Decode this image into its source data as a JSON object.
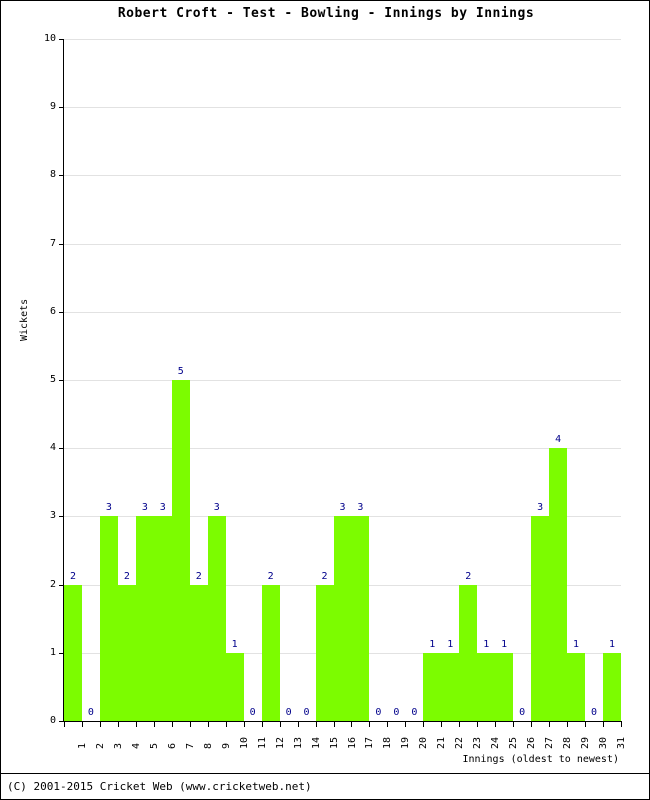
{
  "chart_data": {
    "type": "bar",
    "title": "Robert Croft - Test - Bowling - Innings by Innings",
    "xlabel": "Innings (oldest to newest)",
    "ylabel": "Wickets",
    "ylim": [
      0,
      10
    ],
    "ytick_labels": [
      "0",
      "1",
      "2",
      "3",
      "4",
      "5",
      "6",
      "7",
      "8",
      "9",
      "10"
    ],
    "grid": true,
    "legend": "none",
    "bar_color": "#7CFC00",
    "label_color": "#00008B",
    "gridline_color": "#E2E2E2",
    "axis_color": "#000000",
    "categories": [
      "1",
      "2",
      "3",
      "4",
      "5",
      "6",
      "7",
      "8",
      "9",
      "10",
      "11",
      "12",
      "13",
      "14",
      "15",
      "16",
      "17",
      "18",
      "19",
      "20",
      "21",
      "22",
      "23",
      "24",
      "25",
      "26",
      "27",
      "28",
      "29",
      "30",
      "31"
    ],
    "values": [
      2,
      0,
      3,
      2,
      3,
      3,
      5,
      2,
      3,
      1,
      0,
      2,
      0,
      0,
      2,
      3,
      3,
      0,
      0,
      0,
      1,
      1,
      2,
      1,
      1,
      0,
      3,
      4,
      1,
      0,
      1
    ],
    "data_labels": [
      "2",
      "0",
      "3",
      "2",
      "3",
      "3",
      "5",
      "2",
      "3",
      "1",
      "0",
      "2",
      "0",
      "0",
      "2",
      "3",
      "3",
      "0",
      "0",
      "0",
      "1",
      "1",
      "2",
      "1",
      "1",
      "0",
      "3",
      "4",
      "1",
      "0",
      "1"
    ]
  },
  "footer": {
    "copyright": "(C) 2001-2015 Cricket Web (www.cricketweb.net)"
  }
}
